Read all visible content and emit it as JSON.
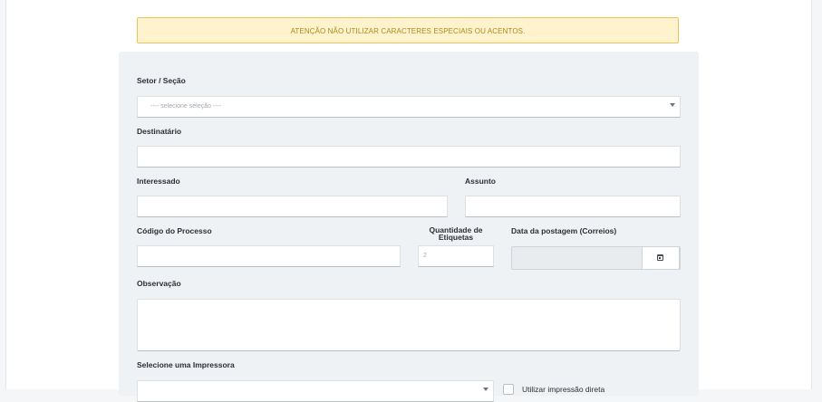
{
  "alert": {
    "text": "ATENÇÃO NÃO UTILIZAR CARACTERES ESPECIAIS OU ACENTOS."
  },
  "form": {
    "setor_label": "Setor / Seção",
    "setor_placeholder": "---- selecione seleção ----",
    "destinatario_label": "Destinatário",
    "destinatario_value": "",
    "interessado_label": "Interessado",
    "interessado_value": "",
    "assunto_label": "Assunto",
    "assunto_value": "",
    "codigo_label": "Código do Processo",
    "codigo_value": "",
    "quantidade_label": "Quantidade de Etiquetas",
    "quantidade_value": "2",
    "data_label": "Data da postagem (Correios)",
    "data_value": "",
    "observacao_label": "Observação",
    "observacao_value": "",
    "impressora_label": "Selecione uma Impressora",
    "impressora_value": "",
    "impressao_direta_label": "Utilizar impressão direta"
  },
  "icons": {
    "select_caret": "chevron-down-icon",
    "date_picker": "calendar-icon"
  },
  "colors": {
    "alert_bg": "#fff3cd",
    "alert_border": "#e8c55a",
    "alert_text": "#a98a19",
    "panel_bg": "#eff2f5"
  }
}
